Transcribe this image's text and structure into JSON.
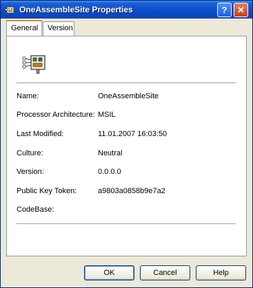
{
  "window": {
    "title": "OneAssembleSite Properties",
    "help_label": "?",
    "close_label": "✕"
  },
  "tabs": [
    {
      "label": "General",
      "active": true
    },
    {
      "label": "Version",
      "active": false
    }
  ],
  "properties": [
    {
      "label": "Name:",
      "value": "OneAssembleSite"
    },
    {
      "label": "Processor Architecture:",
      "value": "MSIL"
    },
    {
      "label": "Last Modified:",
      "value": "11.01.2007 16:03:50"
    },
    {
      "label": "Culture:",
      "value": "Neutral"
    },
    {
      "label": "Version:",
      "value": "0.0.0.0"
    },
    {
      "label": "Public Key Token:",
      "value": "a9803a0858b9e7a2"
    },
    {
      "label": "CodeBase:",
      "value": ""
    }
  ],
  "buttons": {
    "ok": "OK",
    "cancel": "Cancel",
    "help": "Help"
  },
  "icons": {
    "title": "assembly-icon",
    "main": "assembly-icon"
  }
}
